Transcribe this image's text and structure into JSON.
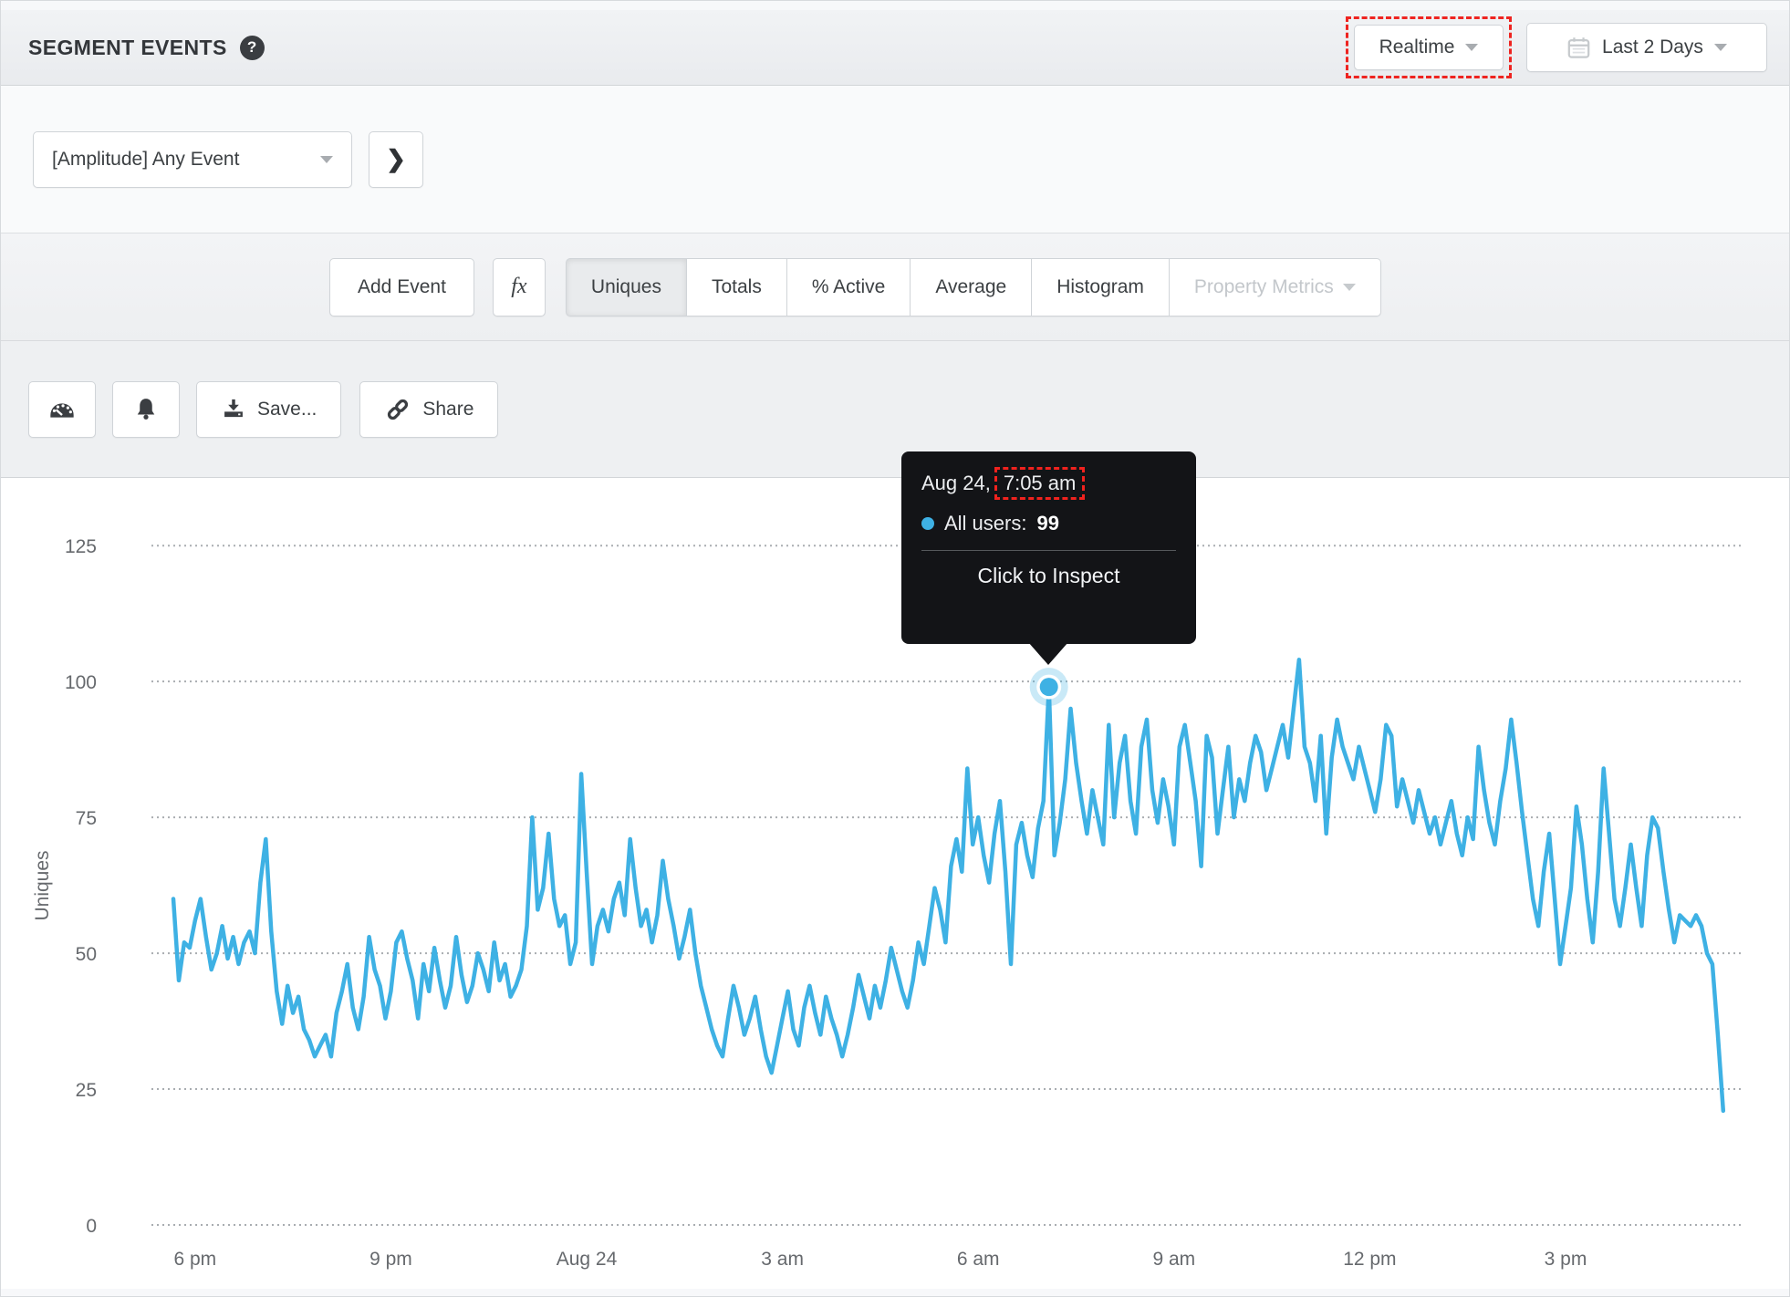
{
  "header": {
    "title": "SEGMENT EVENTS",
    "help_icon": "?",
    "realtime_label": "Realtime",
    "date_range_label": "Last 2 Days"
  },
  "event_row": {
    "event_selector": "[Amplitude] Any Event",
    "expand_icon": "❯"
  },
  "metric_tabs": {
    "add_event_label": "Add Event",
    "formula_label": "fx",
    "tabs": [
      {
        "label": "Uniques",
        "selected": true,
        "disabled": false,
        "has_caret": false
      },
      {
        "label": "Totals",
        "selected": false,
        "disabled": false,
        "has_caret": false
      },
      {
        "label": "% Active",
        "selected": false,
        "disabled": false,
        "has_caret": false
      },
      {
        "label": "Average",
        "selected": false,
        "disabled": false,
        "has_caret": false
      },
      {
        "label": "Histogram",
        "selected": false,
        "disabled": false,
        "has_caret": false
      },
      {
        "label": "Property Metrics",
        "selected": false,
        "disabled": true,
        "has_caret": true
      }
    ]
  },
  "toolbar": {
    "save_label": "Save...",
    "share_label": "Share"
  },
  "tooltip": {
    "date": "Aug 24,",
    "time": "7:05 am",
    "series_label": "All users:",
    "value": "99",
    "action": "Click to Inspect"
  },
  "chart_data": {
    "type": "line",
    "title": "",
    "xlabel": "",
    "ylabel": "Uniques",
    "y_ticks": [
      0,
      25,
      50,
      75,
      100,
      125
    ],
    "ylim": [
      0,
      131
    ],
    "grid": "horizontal-dotted",
    "gridline_color": "#a9adb1",
    "axis_label_color": "#66696d",
    "start_time": "Aug 23, 5:40 pm",
    "interval_minutes": 5,
    "x_ticks": [
      {
        "label": "6 pm",
        "hours_from_start": 0.3333
      },
      {
        "label": "9 pm",
        "hours_from_start": 3.3333
      },
      {
        "label": "Aug 24",
        "hours_from_start": 6.3333
      },
      {
        "label": "3 am",
        "hours_from_start": 9.3333
      },
      {
        "label": "6 am",
        "hours_from_start": 12.3333
      },
      {
        "label": "9 am",
        "hours_from_start": 15.3333
      },
      {
        "label": "12 pm",
        "hours_from_start": 18.3333
      },
      {
        "label": "3 pm",
        "hours_from_start": 21.3333
      }
    ],
    "series": [
      {
        "name": "All users",
        "color": "#3eb1e4",
        "values": [
          60,
          45,
          52,
          51,
          56,
          60,
          53,
          47,
          50,
          55,
          49,
          53,
          48,
          52,
          54,
          50,
          63,
          71,
          54,
          43,
          37,
          44,
          39,
          42,
          36,
          34,
          31,
          33,
          35,
          31,
          39,
          43,
          48,
          40,
          36,
          42,
          53,
          47,
          44,
          38,
          43,
          52,
          54,
          49,
          45,
          38,
          48,
          43,
          51,
          45,
          40,
          44,
          53,
          46,
          41,
          44,
          50,
          47,
          43,
          52,
          45,
          48,
          42,
          44,
          47,
          55,
          75,
          58,
          62,
          72,
          60,
          55,
          57,
          48,
          52,
          83,
          65,
          48,
          55,
          58,
          54,
          60,
          63,
          57,
          71,
          62,
          55,
          58,
          52,
          57,
          67,
          60,
          55,
          49,
          53,
          58,
          50,
          44,
          40,
          36,
          33,
          31,
          38,
          44,
          40,
          35,
          38,
          42,
          36,
          31,
          28,
          33,
          38,
          43,
          36,
          33,
          40,
          44,
          39,
          35,
          42,
          38,
          35,
          31,
          35,
          40,
          46,
          42,
          38,
          44,
          40,
          45,
          51,
          47,
          43,
          40,
          45,
          52,
          48,
          55,
          62,
          58,
          52,
          66,
          71,
          65,
          84,
          70,
          75,
          68,
          63,
          72,
          78,
          65,
          48,
          70,
          74,
          68,
          64,
          73,
          78,
          99,
          68,
          74,
          82,
          95,
          85,
          78,
          72,
          80,
          75,
          70,
          92,
          75,
          85,
          90,
          78,
          72,
          88,
          93,
          80,
          74,
          82,
          77,
          70,
          88,
          92,
          85,
          78,
          66,
          90,
          86,
          72,
          80,
          88,
          75,
          82,
          78,
          85,
          90,
          87,
          80,
          84,
          88,
          92,
          86,
          95,
          104,
          88,
          85,
          78,
          90,
          72,
          86,
          93,
          88,
          85,
          82,
          88,
          84,
          80,
          76,
          82,
          92,
          90,
          77,
          82,
          78,
          74,
          80,
          76,
          72,
          75,
          70,
          74,
          78,
          72,
          68,
          75,
          71,
          88,
          80,
          74,
          70,
          78,
          84,
          93,
          85,
          76,
          68,
          60,
          55,
          65,
          72,
          60,
          48,
          55,
          62,
          77,
          70,
          60,
          52,
          65,
          84,
          72,
          60,
          55,
          62,
          70,
          62,
          55,
          68,
          75,
          73,
          65,
          58,
          52,
          57,
          56,
          55,
          57,
          55,
          50,
          48,
          35,
          21
        ]
      }
    ],
    "highlight": {
      "series": "All users",
      "index": 161,
      "value": 99,
      "time": "Aug 24, 7:05 am"
    }
  }
}
